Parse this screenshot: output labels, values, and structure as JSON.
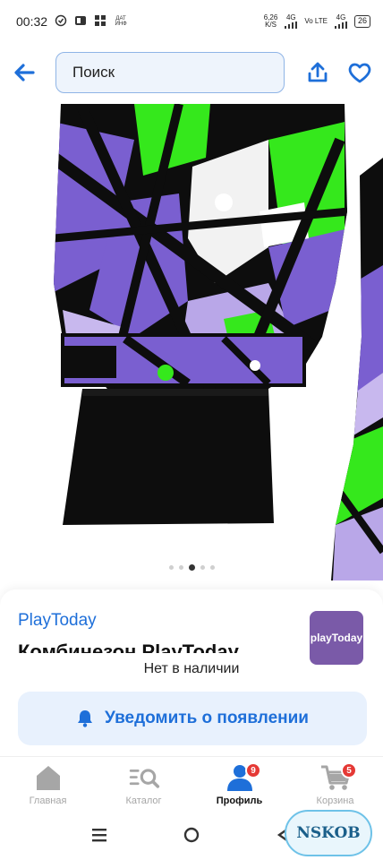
{
  "status_bar": {
    "time": "00:32",
    "left_tiny_label": "ДАТ ИНФ",
    "speed": "6,26",
    "speed_unit": "K/S",
    "net1": "4G",
    "net2": "Vo LTE",
    "net3": "4G",
    "battery": "26"
  },
  "top_bar": {
    "search_placeholder": "Поиск"
  },
  "gallery": {
    "dots_total": 5,
    "active_index": 2
  },
  "product": {
    "brand": "PlayToday",
    "title": "Комбинезон PlayToday",
    "brand_logo_text": "playToday",
    "availability": "Нет в наличии",
    "notify_label": "Уведомить о появлении"
  },
  "bottom_nav": {
    "items": [
      {
        "label": "Главная",
        "badge": ""
      },
      {
        "label": "Каталог",
        "badge": ""
      },
      {
        "label": "Профиль",
        "badge": "9"
      },
      {
        "label": "Корзина",
        "badge": "5"
      }
    ],
    "active_index": 2
  },
  "watermark": "NSKOB",
  "colors": {
    "accent": "#1e6fd9",
    "badge": "#e53935",
    "print_purple": "#7a5fd0",
    "print_green": "#35e81c",
    "fabric_black": "#0d0d0d"
  }
}
